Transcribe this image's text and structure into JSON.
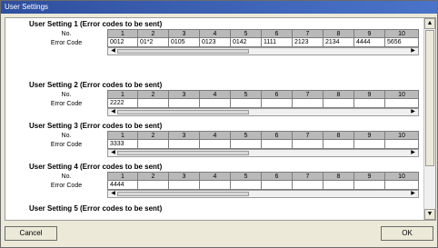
{
  "window": {
    "title": "User Settings"
  },
  "labels": {
    "no": "No.",
    "error_code": "Error Code"
  },
  "columns": [
    "1",
    "2",
    "3",
    "4",
    "5",
    "6",
    "7",
    "8",
    "9",
    "10"
  ],
  "groups": [
    {
      "title": "User Setting 1 (Error codes to be sent)",
      "values": [
        "0012",
        "01*2",
        "0105",
        "0123",
        "0142",
        "1111",
        "2123",
        "2134",
        "4444",
        "5656"
      ]
    },
    {
      "title": "User Setting 2 (Error codes to be sent)",
      "values": [
        "2222",
        "",
        "",
        "",
        "",
        "",
        "",
        "",
        "",
        ""
      ]
    },
    {
      "title": "User Setting 3 (Error codes to be sent)",
      "values": [
        "3333",
        "",
        "",
        "",
        "",
        "",
        "",
        "",
        "",
        ""
      ]
    },
    {
      "title": "User Setting 4 (Error codes to be sent)",
      "values": [
        "4444",
        "",
        "",
        "",
        "",
        "",
        "",
        "",
        "",
        ""
      ]
    },
    {
      "title": "User Setting 5 (Error codes to be sent)",
      "values": []
    }
  ],
  "buttons": {
    "cancel": "Cancel",
    "ok": "OK"
  },
  "icons": {
    "scroll_up": "triangle-up-icon",
    "scroll_down": "triangle-down-icon",
    "scroll_left": "triangle-left-icon",
    "scroll_right": "triangle-right-icon"
  }
}
